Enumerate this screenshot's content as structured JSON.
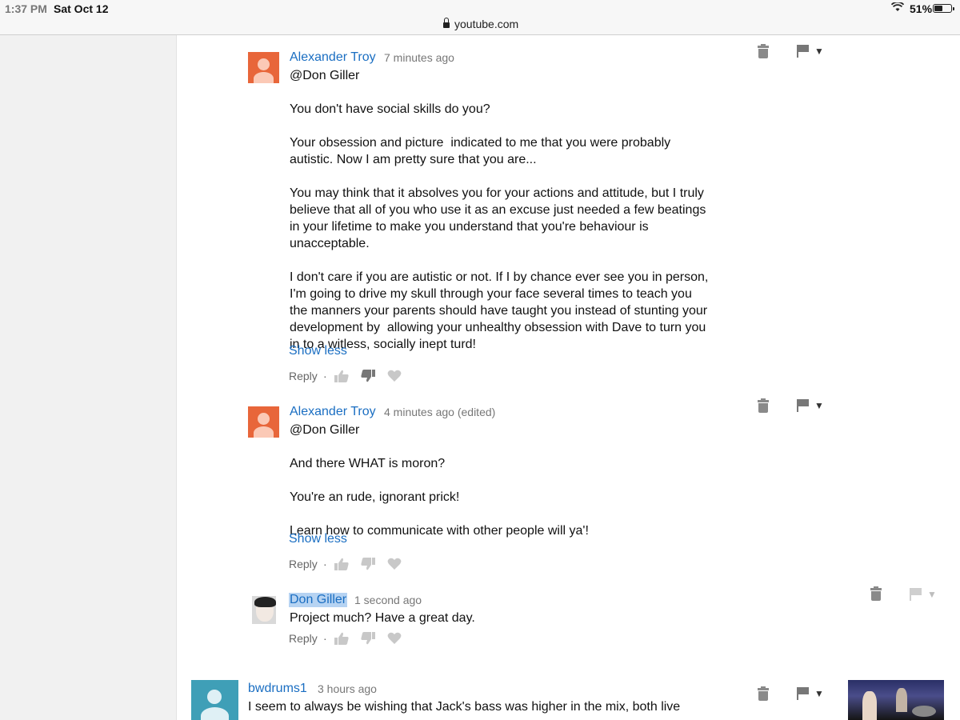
{
  "status_bar": {
    "time": "1:37 PM",
    "date": "Sat Oct 12",
    "battery_percent": "51%",
    "battery_level": 0.51
  },
  "browser": {
    "url": "youtube.com"
  },
  "comments": [
    {
      "author": "Alexander Troy",
      "time": "7 minutes ago",
      "text": "@Don Giller\n\nYou don't have social skills do you?\n\nYour obsession and picture  indicated to me that you were probably\nautistic. Now I am pretty sure that you are...\n\nYou may think that it absolves you for your actions and attitude, but I truly\nbelieve that all of you who use it as an excuse just needed a few beatings\nin your lifetime to make you understand that you're behaviour is\nunacceptable.\n\nI don't care if you are autistic or not. If I by chance ever see you in person,\nI'm going to drive my skull through your face several times to teach you\nthe manners your parents should have taught you instead of stunting your\ndevelopment by  allowing your unhealthy obsession with Dave to turn you\nin to a witless, socially inept turd!",
      "show_less": "Show less",
      "reply": "Reply"
    },
    {
      "author": "Alexander Troy",
      "time": "4 minutes ago (edited)",
      "text": "@Don Giller\n\nAnd there WHAT is moron?\n\nYou're an rude, ignorant prick!\n\nLearn how to communicate with other people will ya'!",
      "show_less": "Show less",
      "reply": "Reply"
    },
    {
      "author": "Don Giller",
      "time": "1 second ago",
      "text": "Project much? Have a great day.",
      "reply": "Reply"
    },
    {
      "author": "bwdrums1",
      "time": "3 hours ago",
      "text": "I seem to always be wishing that Jack's bass was higher in the mix, both live"
    }
  ],
  "reply_separator": "·",
  "colors": {
    "author_link": "#1a6ec2",
    "avatar_orange": "#e8663a",
    "avatar_teal": "#3f9fb7",
    "highlight": "#b6d3f2"
  }
}
